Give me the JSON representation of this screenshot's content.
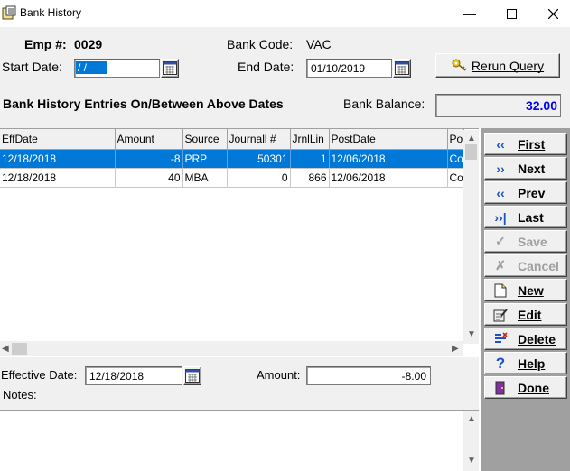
{
  "window": {
    "title": "Bank History"
  },
  "header": {
    "emp_label": "Emp #:",
    "emp_value": "0029",
    "bank_code_label": "Bank Code:",
    "bank_code_value": "VAC",
    "start_date_label": "Start Date:",
    "start_date_value": " / /",
    "end_date_label": "End Date:",
    "end_date_value": "01/10/2019",
    "rerun_label": "Rerun Query",
    "entries_label": "Bank History Entries On/Between Above Dates",
    "balance_label": "Bank Balance:",
    "balance_value": "32.00"
  },
  "grid": {
    "columns": [
      "EffDate",
      "Amount",
      "Source",
      "Journall #",
      "JrnlLin",
      "PostDate",
      "Po"
    ],
    "rows": [
      [
        "12/18/2018",
        "-8",
        "PRP",
        "50301",
        "1",
        "12/06/2018",
        "Co"
      ],
      [
        "12/18/2018",
        "40",
        "MBA",
        "0",
        "866",
        "12/06/2018",
        "Co"
      ]
    ],
    "selected_row": 0
  },
  "detail": {
    "eff_date_label": "Effective Date:",
    "eff_date_value": "12/18/2018",
    "amount_label": "Amount:",
    "amount_value": "-8.00",
    "notes_label": "Notes:"
  },
  "nav": {
    "first": "First",
    "next": "Next",
    "prev": "Prev",
    "last": "Last",
    "save": "Save",
    "cancel": "Cancel",
    "new": "New",
    "edit": "Edit",
    "delete": "Delete",
    "help": "Help",
    "done": "Done"
  },
  "colors": {
    "selection": "#0078d7",
    "balance_text": "#0000ff",
    "nav_arrow": "#1e50c8"
  }
}
